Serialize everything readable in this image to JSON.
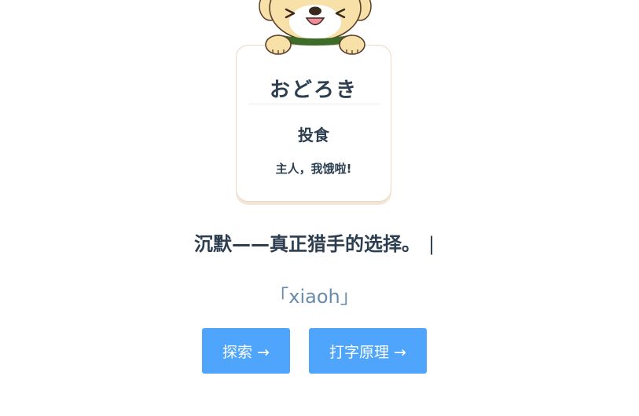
{
  "card": {
    "title": "おどろき",
    "action": "投食",
    "message": "主人，我饿啦!"
  },
  "tagline": {
    "text": "沉默——真正猎手的选择。",
    "cursor": "|"
  },
  "reading": "「xiaoh」",
  "buttons": {
    "explore": "探索 →",
    "typing_principle": "打字原理 →"
  },
  "colors": {
    "primary_text": "#2c3e50",
    "accent_blue": "#4fa5fb",
    "reading_text": "#6a8bad",
    "dog_fur": "#f8e1a8",
    "card_border": "#ead9c6"
  },
  "icons": {
    "mascot": "puppy-mascot-icon"
  }
}
